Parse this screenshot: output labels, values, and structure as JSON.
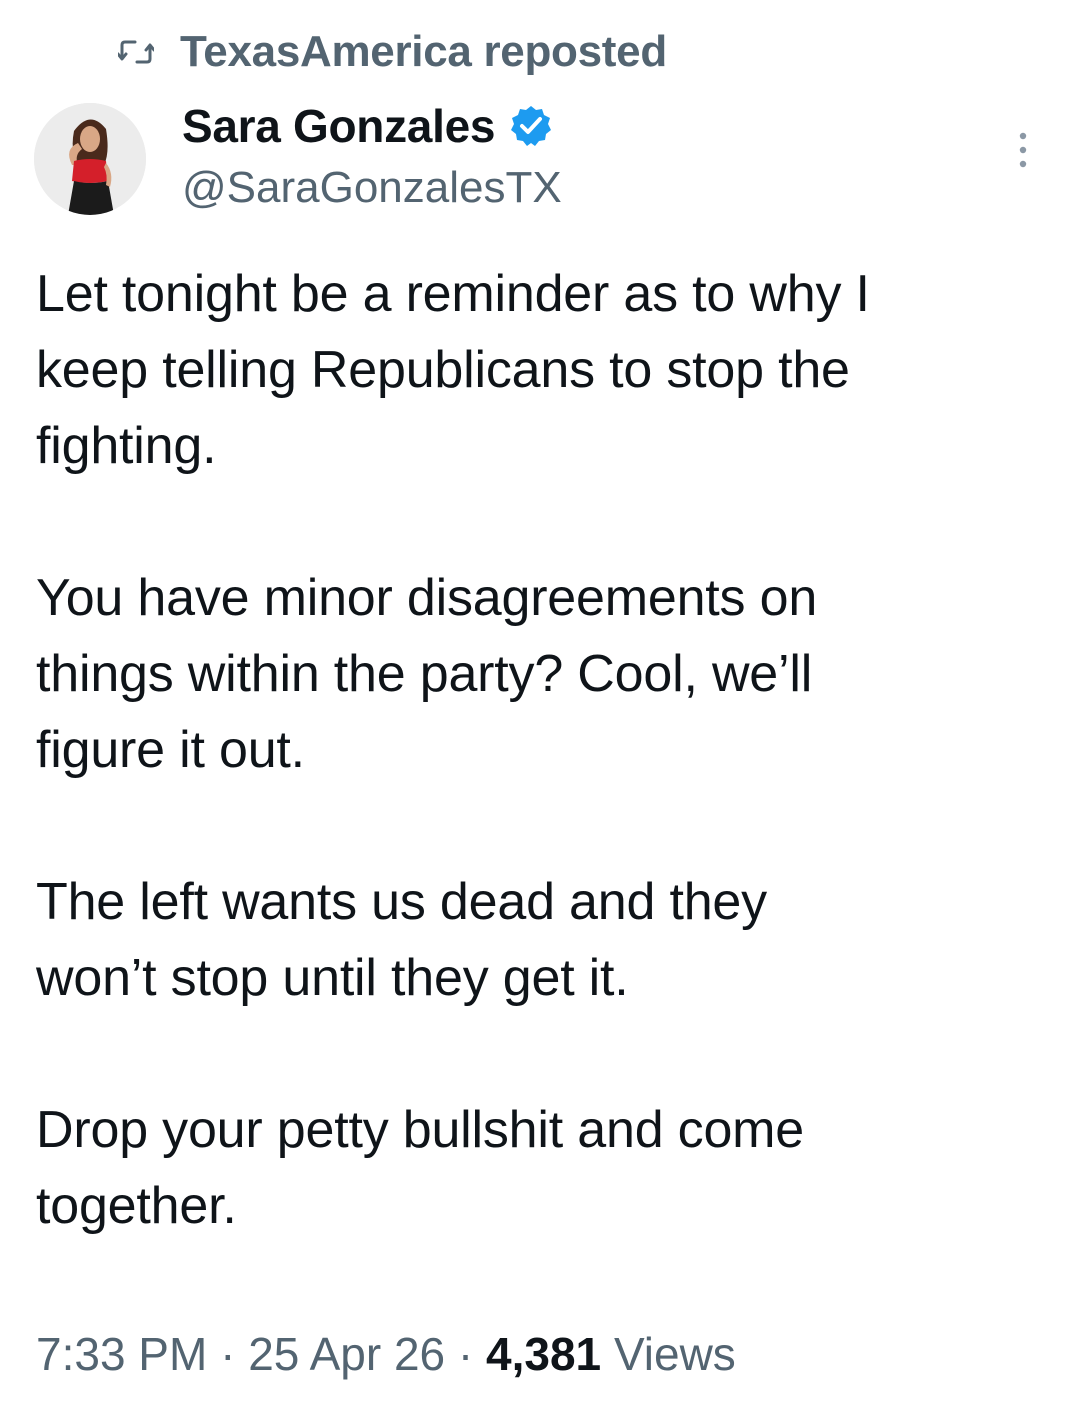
{
  "repost": {
    "label": "TexasAmerica reposted",
    "icon": "repost-icon"
  },
  "author": {
    "display_name": "Sara Gonzales",
    "handle": "@SaraGonzalesTX",
    "verified": true,
    "verified_color": "#1d9bf0",
    "avatar_icon": "avatar"
  },
  "more_icon": "more-vertical-icon",
  "tweet": {
    "paragraphs": [
      "Let tonight be a reminder as to why I\nkeep telling Republicans to stop the\nfighting.",
      "You have minor disagreements on\nthings within the party? Cool, we’ll\nfigure it out.",
      "The left wants us dead and they\nwon’t stop until they get it.",
      "Drop your petty bullshit and come\ntogether."
    ]
  },
  "meta": {
    "time": "7:33 PM",
    "separator": "·",
    "date": "25 Apr 26",
    "views_count": "4,381",
    "views_label": "Views"
  },
  "colors": {
    "text_primary": "#0f1419",
    "text_secondary": "#536471",
    "background": "#ffffff"
  }
}
